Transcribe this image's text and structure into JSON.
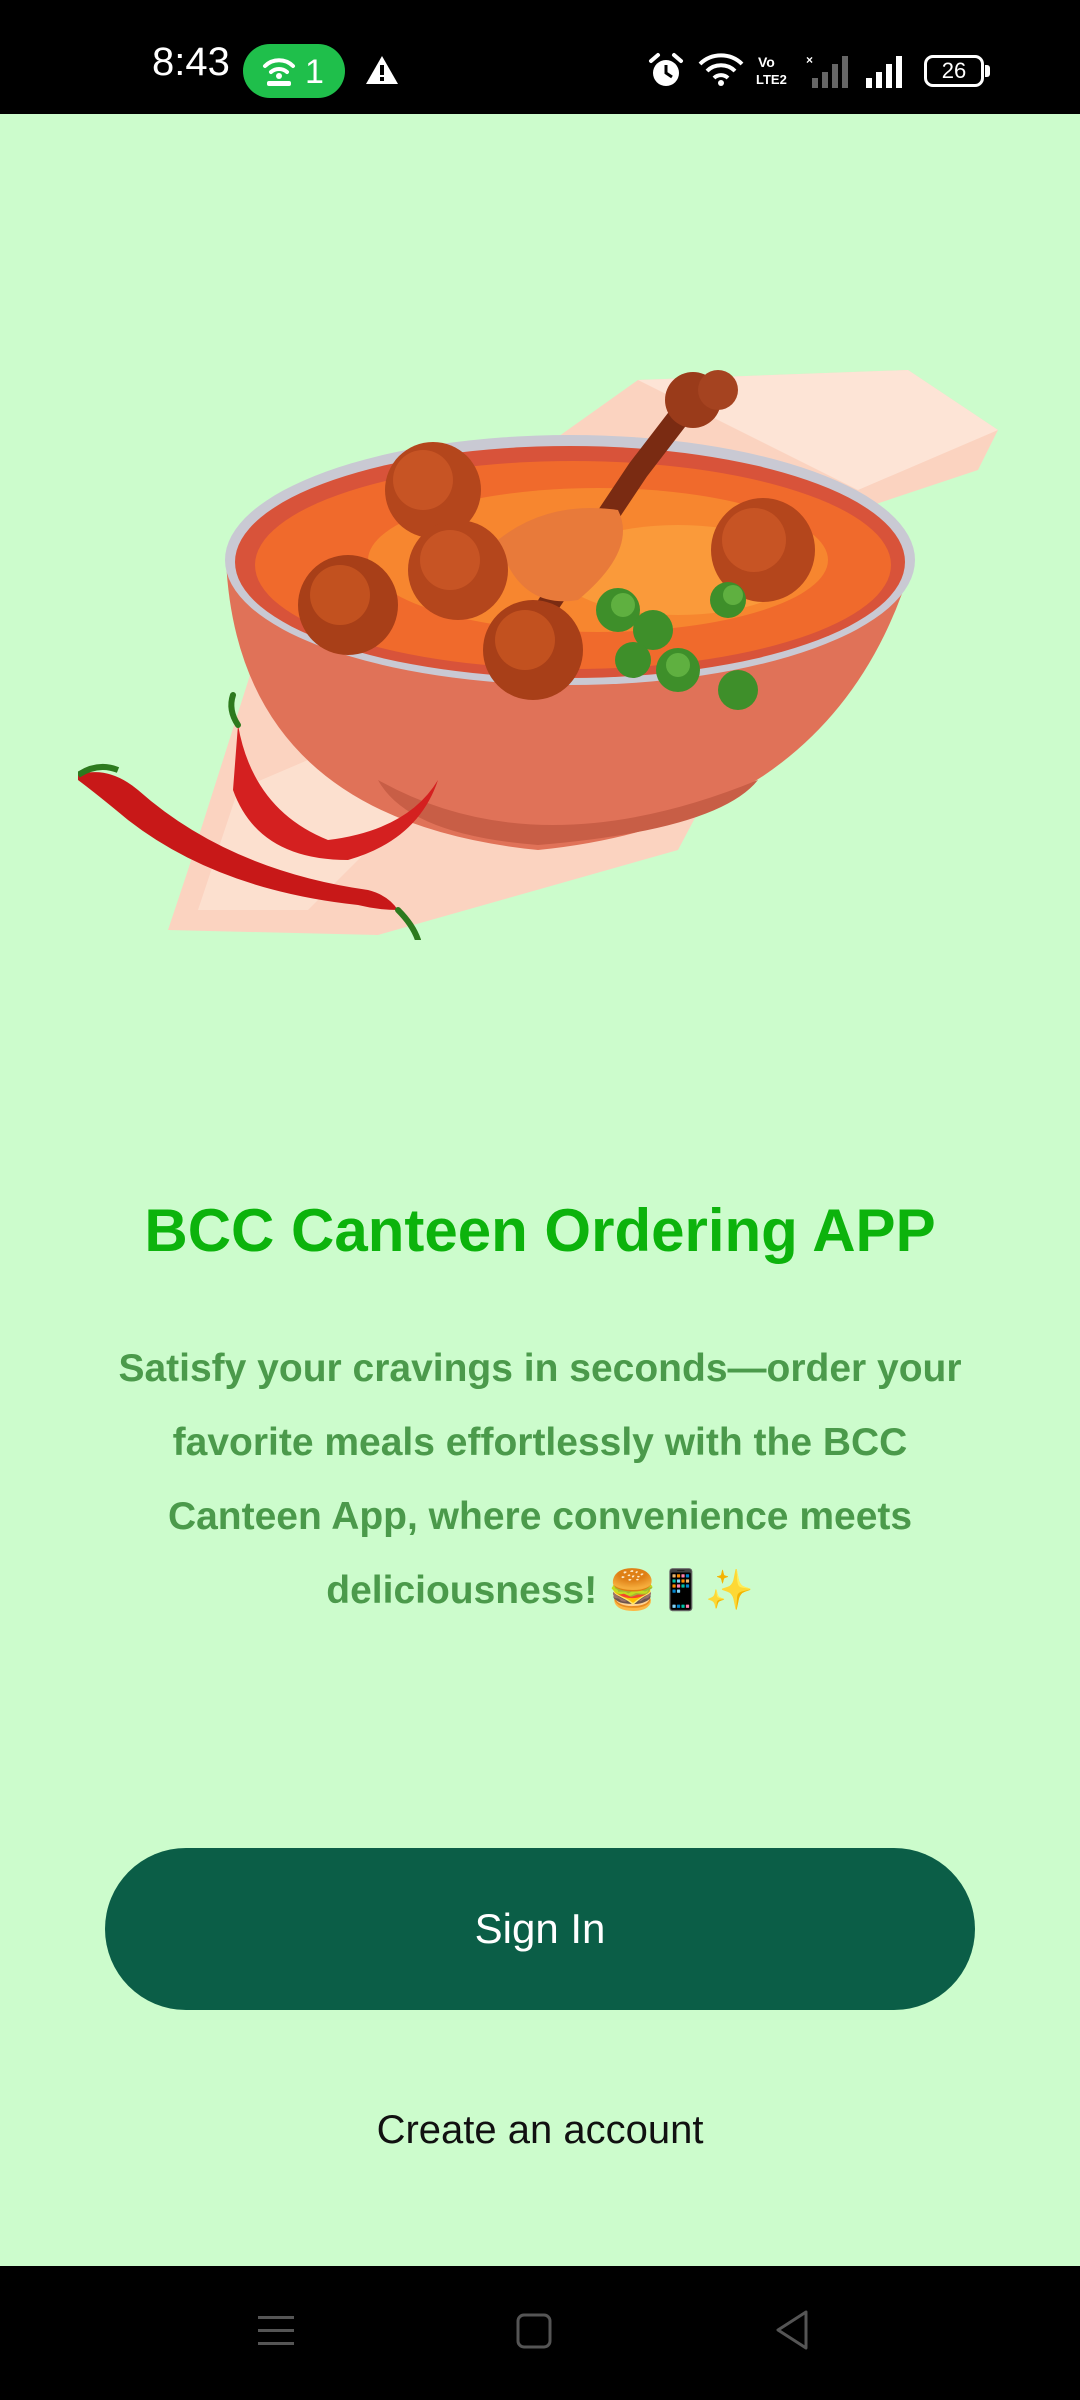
{
  "status_bar": {
    "time": "8:43",
    "hotspot_count": "1",
    "battery_level": "26",
    "icons": [
      "hotspot-icon",
      "warning-icon",
      "alarm-icon",
      "wifi-icon",
      "volte-icon",
      "signal-icon",
      "signal-icon",
      "battery-icon"
    ]
  },
  "hero": {
    "icon": "curry-bowl-illustration"
  },
  "app": {
    "title": "BCC Canteen Ordering APP",
    "tagline": "Satisfy your cravings in seconds—order your favorite meals effortlessly with the BCC Canteen App, where convenience meets deliciousness! 🍔📱✨"
  },
  "actions": {
    "sign_in_label": "Sign In",
    "create_account_label": "Create an account"
  },
  "nav_bar": {
    "icons": [
      "menu-icon",
      "home-icon",
      "back-icon"
    ]
  },
  "colors": {
    "background": "#ccfccc",
    "title": "#0cb30c",
    "tagline": "#4b9a4b",
    "button": "#0b5e47"
  }
}
